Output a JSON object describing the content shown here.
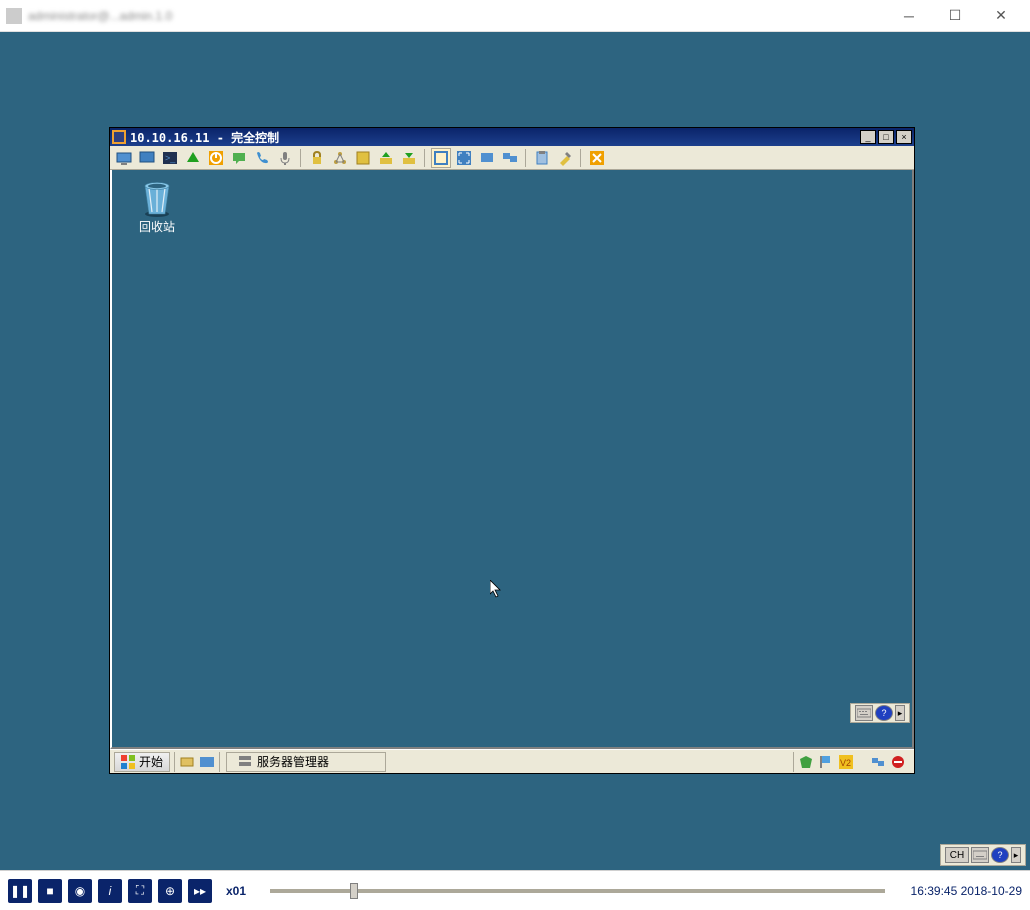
{
  "app": {
    "title_blurred": "administrator@...admin.1.0"
  },
  "remote": {
    "title": "10.10.16.11 - 完全控制",
    "toolbar_icons": [
      "monitor",
      "desktop",
      "terminal",
      "upload",
      "power",
      "chat",
      "phone",
      "mic",
      "lock",
      "network",
      "settings",
      "upload2",
      "download",
      "window",
      "fullscreen",
      "clone",
      "multi",
      "info",
      "tools",
      "close"
    ],
    "desktop": {
      "recycle_bin": "回收站"
    },
    "taskbar": {
      "start": "开始",
      "task1": "服务器管理器"
    },
    "status_ch": "CH"
  },
  "player": {
    "speed": "x01",
    "time": "16:39:45",
    "date": "2018-10-29"
  }
}
